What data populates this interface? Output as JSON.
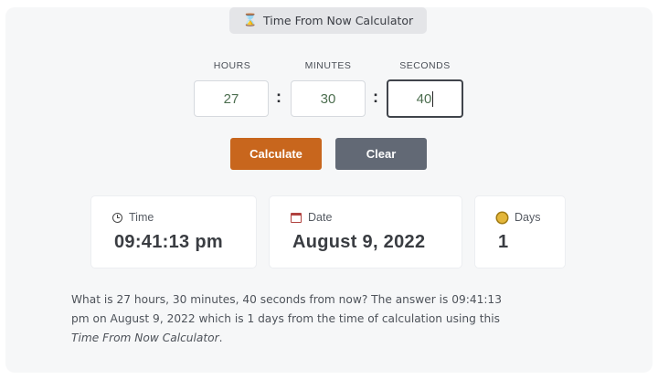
{
  "header": {
    "icon": "hourglass-icon",
    "title": "Time From Now Calculator"
  },
  "inputs": {
    "hours": {
      "label": "HOURS",
      "value": "27"
    },
    "minutes": {
      "label": "MINUTES",
      "value": "30"
    },
    "seconds": {
      "label": "SECONDS",
      "value": "40"
    },
    "separator": ":"
  },
  "buttons": {
    "calculate": "Calculate",
    "clear": "Clear"
  },
  "results": {
    "time": {
      "label": "Time",
      "value": "09:41:13 pm",
      "icon": "clock-icon"
    },
    "date": {
      "label": "Date",
      "value": "August 9, 2022",
      "icon": "calendar-icon"
    },
    "days": {
      "label": "Days",
      "value": "1",
      "icon": "sun-icon"
    }
  },
  "description": {
    "line1": "What is 27 hours, 30 minutes, 40 seconds from now? The answer is 09:41:13",
    "line2": "pm on August 9, 2022 which is 1 days from the time of calculation using this",
    "line3_link": "Time From Now Calculator",
    "line3_end": "."
  },
  "colors": {
    "calculate_button": "#c8661d",
    "clear_button": "#626975",
    "input_text": "#4c6e4f"
  }
}
